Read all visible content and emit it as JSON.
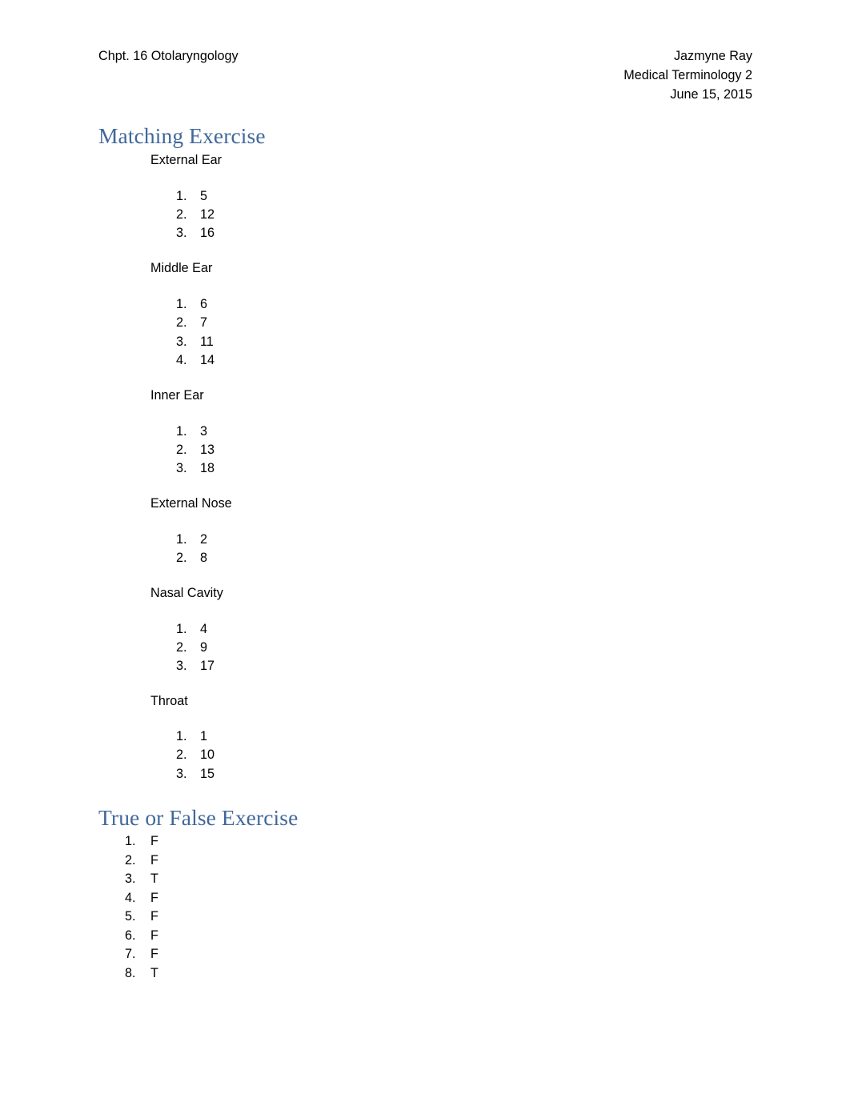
{
  "header": {
    "left_title": "Chpt. 16 Otolaryngology",
    "right_lines": [
      "Jazmyne Ray",
      "Medical Terminology 2",
      "June 15, 2015"
    ],
    "author": "Jazmyne Ray",
    "course": "Medical Terminology 2",
    "date": "June 15, 2015"
  },
  "theme": {
    "heading_color": "#41689B",
    "body_color": "#000000",
    "page_background": "#ffffff"
  },
  "sections": [
    {
      "heading": "Matching Exercise",
      "groups": [
        {
          "label": "External Ear",
          "items": [
            {
              "num": "1.",
              "value": "5"
            },
            {
              "num": "2.",
              "value": "12"
            },
            {
              "num": "3.",
              "value": "16"
            }
          ]
        },
        {
          "label": "Middle Ear",
          "items": [
            {
              "num": "1.",
              "value": "6"
            },
            {
              "num": "2.",
              "value": "7"
            },
            {
              "num": "3.",
              "value": "11"
            },
            {
              "num": "4.",
              "value": "14"
            }
          ]
        },
        {
          "label": "Inner Ear",
          "items": [
            {
              "num": "1.",
              "value": "3"
            },
            {
              "num": "2.",
              "value": "13"
            },
            {
              "num": "3.",
              "value": "18"
            }
          ]
        },
        {
          "label": "External Nose",
          "items": [
            {
              "num": "1.",
              "value": "2"
            },
            {
              "num": "2.",
              "value": "8"
            }
          ]
        },
        {
          "label": "Nasal Cavity",
          "items": [
            {
              "num": "1.",
              "value": "4"
            },
            {
              "num": "2.",
              "value": "9"
            },
            {
              "num": "3.",
              "value": "17"
            }
          ]
        },
        {
          "label": "Throat",
          "items": [
            {
              "num": "1.",
              "value": "1"
            },
            {
              "num": "2.",
              "value": "10"
            },
            {
              "num": "3.",
              "value": "15"
            }
          ]
        }
      ]
    },
    {
      "heading": "True or False Exercise",
      "items": [
        {
          "num": "1.",
          "value": "F"
        },
        {
          "num": "2.",
          "value": "F"
        },
        {
          "num": "3.",
          "value": "T"
        },
        {
          "num": "4.",
          "value": "F"
        },
        {
          "num": "5.",
          "value": "F"
        },
        {
          "num": "6.",
          "value": "F"
        },
        {
          "num": "7.",
          "value": "F"
        },
        {
          "num": "8.",
          "value": "T"
        }
      ]
    }
  ]
}
